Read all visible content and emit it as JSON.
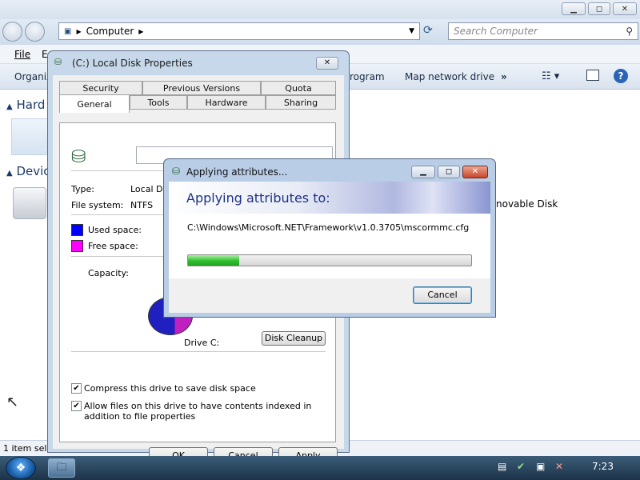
{
  "explorer": {
    "address_path": "Computer",
    "search_placeholder": "Search Computer",
    "menu": {
      "file": "File",
      "edit_partial": "E"
    },
    "commands": {
      "organize_partial": "Organiz",
      "program_partial": "rogram",
      "map_network_drive": "Map network drive",
      "more": "»"
    },
    "left_labels": {
      "hard": "Hard",
      "devices": "Device"
    },
    "removable_label": "novable Disk",
    "status": "1 item sele"
  },
  "props": {
    "title": "(C:) Local Disk Properties",
    "close_label": "✕",
    "tabs_row1": [
      "Security",
      "Previous Versions",
      "Quota"
    ],
    "tabs_row2": [
      "General",
      "Tools",
      "Hardware",
      "Sharing"
    ],
    "selected_tab": "General",
    "type_label": "Type:",
    "type_value": "Local Dis",
    "fs_label": "File system:",
    "fs_value": "NTFS",
    "used_label": "Used space:",
    "free_label": "Free space:",
    "capacity_label": "Capacity:",
    "drive_label": "Drive C:",
    "disk_cleanup": "Disk Cleanup",
    "compress_label": "Compress this drive to save disk space",
    "compress_checked": true,
    "index_label": "Allow files on this drive to have contents indexed in addition to file properties",
    "index_checked": true,
    "ok": "OK",
    "cancel": "Cancel",
    "apply": "Apply",
    "colors": {
      "used": "#0000ff",
      "free": "#ff00ff"
    }
  },
  "apply_dialog": {
    "title": "Applying attributes...",
    "heading": "Applying attributes to:",
    "path": "C:\\Windows\\Microsoft.NET\\Framework\\v1.0.3705\\mscormmc.cfg",
    "progress_percent": 18,
    "cancel": "Cancel",
    "minimize_label": "▁",
    "maximize_label": "◻",
    "close_label": "✕"
  },
  "taskbar": {
    "clock": "7:23",
    "start_icon": "windows-orb-icon",
    "pinned_icon": "explorer-folder-icon"
  }
}
